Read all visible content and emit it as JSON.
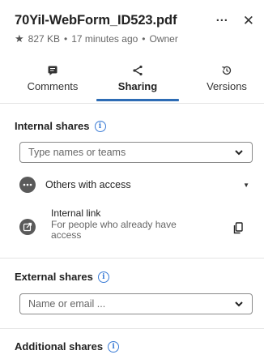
{
  "header": {
    "file_name": "70Yil-WebForm_ID523.pdf",
    "more_label": "···",
    "close_label": "✕",
    "size": "827 KB",
    "time": "17 minutes ago",
    "role": "Owner",
    "separator": "•"
  },
  "tabs": [
    {
      "label": "Comments",
      "icon": "comment-icon",
      "active": false
    },
    {
      "label": "Sharing",
      "icon": "share-icon",
      "active": true
    },
    {
      "label": "Versions",
      "icon": "history-icon",
      "active": false
    }
  ],
  "internal_shares": {
    "title": "Internal shares",
    "placeholder": "Type names or teams",
    "others_label": "Others with access",
    "link_title": "Internal link",
    "link_desc": "For people who already have access"
  },
  "external_shares": {
    "title": "External shares",
    "placeholder": "Name or email ..."
  },
  "additional_shares": {
    "title": "Additional shares"
  },
  "colors": {
    "accent": "#2d6cb5",
    "info": "#3a7bd5",
    "icon_dark": "#5a5a5a"
  }
}
